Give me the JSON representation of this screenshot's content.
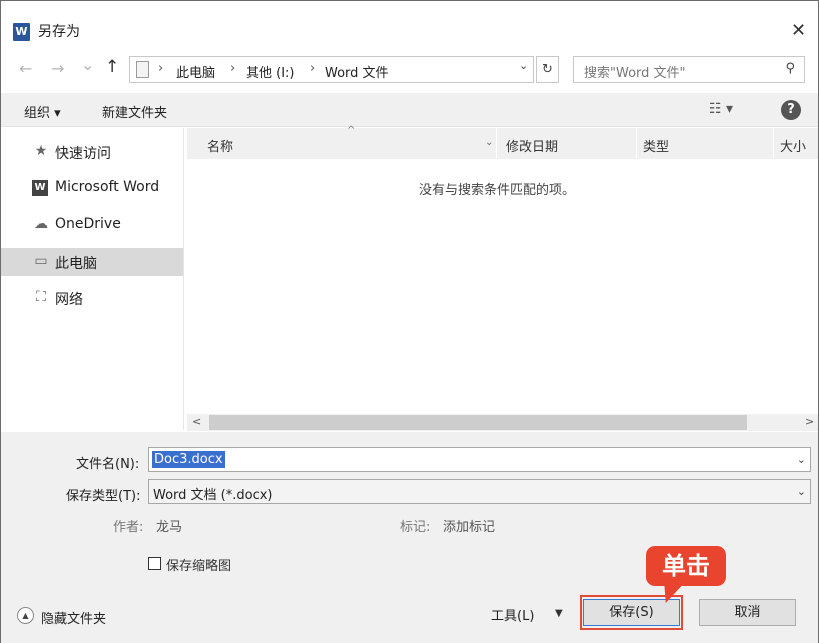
{
  "window": {
    "title": "另存为",
    "app_icon": "word-icon",
    "close_glyph": "✕"
  },
  "nav": {
    "back_glyph": "←",
    "forward_glyph": "→",
    "recent_glyph": "⌄",
    "up_glyph": "↑",
    "breadcrumbs": [
      "此电脑",
      "其他 (I:)",
      "Word 文件"
    ],
    "crumb_sep": "›",
    "dropdown_glyph": "⌄",
    "refresh_glyph": "↻",
    "search_placeholder": "搜索\"Word 文件\"",
    "search_glyph": "⚲"
  },
  "toolbar": {
    "organize": "组织 ▾",
    "new_folder": "新建文件夹",
    "view_glyph": "☷ ▾",
    "help_glyph": "?"
  },
  "sidebar": {
    "items": [
      {
        "label": "快速访问",
        "icon": "star-icon",
        "glyph": "★"
      },
      {
        "label": "Microsoft Word",
        "icon": "word-icon",
        "glyph": "W"
      },
      {
        "label": "OneDrive",
        "icon": "cloud-icon",
        "glyph": "☁"
      },
      {
        "label": "此电脑",
        "icon": "computer-icon",
        "glyph": "▭",
        "selected": true
      },
      {
        "label": "网络",
        "icon": "network-icon",
        "glyph": "⛶"
      }
    ]
  },
  "list": {
    "columns": [
      "名称",
      "修改日期",
      "类型",
      "大小"
    ],
    "sort_glyph": "^",
    "col_drop_glyph": "⌄",
    "empty_message": "没有与搜索条件匹配的项。",
    "scroll_left": "<",
    "scroll_right": ">"
  },
  "form": {
    "filename_label": "文件名(N):",
    "filename_value": "Doc3.docx",
    "filetype_label": "保存类型(T):",
    "filetype_value": "Word 文档 (*.docx)",
    "author_label": "作者:",
    "author_value": "龙马",
    "tags_label": "标记:",
    "tags_value": "添加标记",
    "thumbnail_label": "保存缩略图",
    "thumbnail_checked": false,
    "hide_folders": "隐藏文件夹",
    "hide_glyph": "▲",
    "tools_label": "工具(L)",
    "tools_glyph": "▼",
    "save_button": "保存(S)",
    "cancel_button": "取消",
    "drop_glyph": "⌄"
  },
  "annotation": {
    "callout_text": "单击",
    "color": "#e8442e"
  }
}
